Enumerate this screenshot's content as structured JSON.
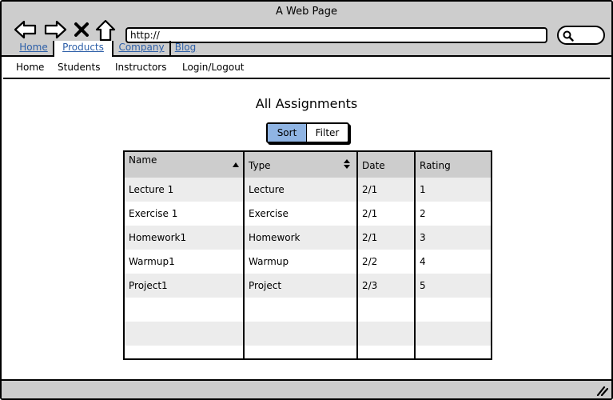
{
  "window": {
    "title": "A Web Page"
  },
  "browser": {
    "url": "http://",
    "tabs": [
      {
        "label": "Home",
        "active": false
      },
      {
        "label": "Products",
        "active": true
      },
      {
        "label": "Company",
        "active": false
      },
      {
        "label": "Blog",
        "active": false
      }
    ],
    "icons": [
      "back-arrow-icon",
      "forward-arrow-icon",
      "close-x-icon",
      "home-up-arrow-icon",
      "search-icon",
      "resize-grip-icon"
    ]
  },
  "menubar": {
    "items": [
      "Home",
      "Students",
      "Instructors",
      "Login/Logout"
    ]
  },
  "page": {
    "title": "All Assignments",
    "segmented": {
      "sort": "Sort",
      "filter": "Filter",
      "selected": "Sort"
    }
  },
  "table": {
    "columns": [
      {
        "label": "Name",
        "sort": "ascending"
      },
      {
        "label": "Type",
        "sort": "sortable"
      },
      {
        "label": "Date",
        "sort": "none"
      },
      {
        "label": "Rating",
        "sort": "none"
      }
    ],
    "rows": [
      [
        "Lecture 1",
        "Lecture",
        "2/1",
        "1"
      ],
      [
        "Exercise 1",
        "Exercise",
        "2/1",
        "2"
      ],
      [
        "Homework1",
        "Homework",
        "2/1",
        "3"
      ],
      [
        "Warmup1",
        "Warmup",
        "2/2",
        "4"
      ],
      [
        "Project1",
        "Project",
        "2/3",
        "5"
      ]
    ]
  },
  "colors": {
    "chrome": "#cdcdcd",
    "link": "#2d5fa8",
    "selected": "#8fb4e3",
    "row_alt": "#ececec"
  }
}
